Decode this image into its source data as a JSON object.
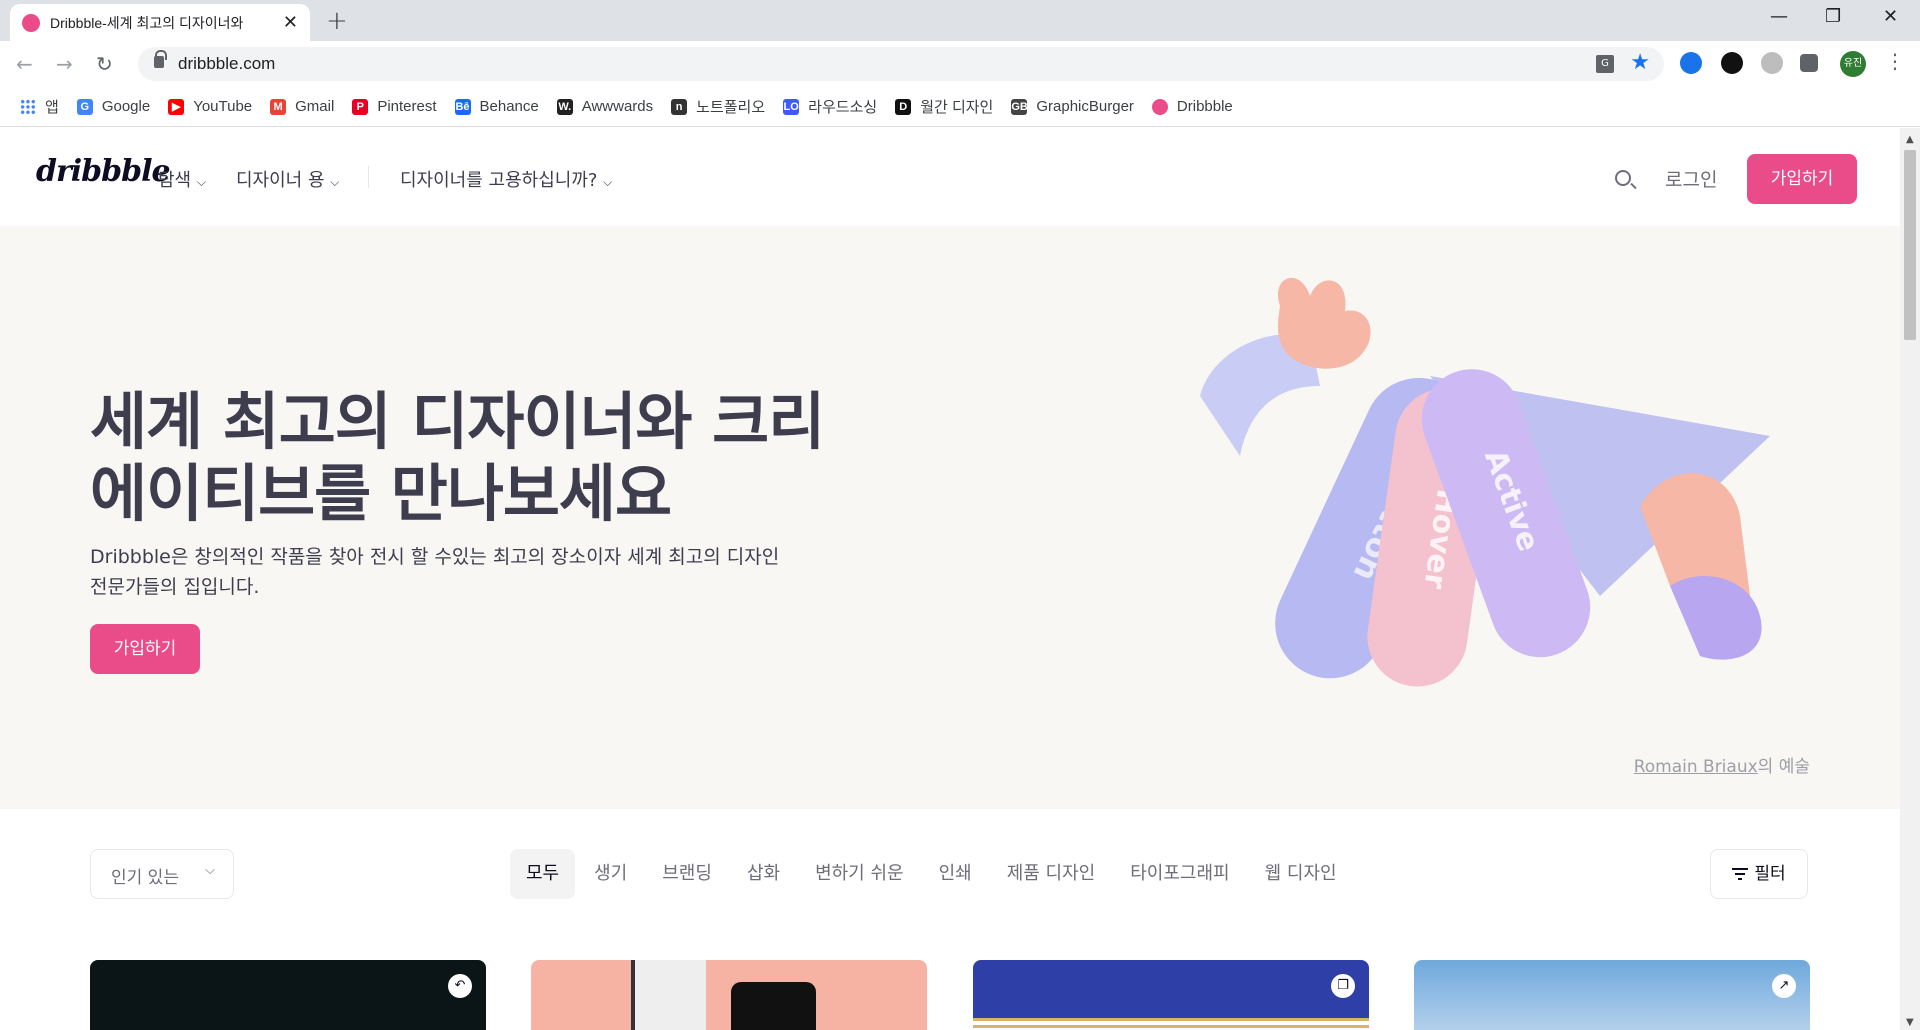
{
  "browser": {
    "tab_title": "Dribbble-세계 최고의 디자이너와",
    "tab_close": "✕",
    "new_tab": "+",
    "url": "dribbble.com",
    "translate_glyph": "G",
    "profile_initials": "유진",
    "window_controls": {
      "minimize": "—",
      "maximize": "❐",
      "close": "✕"
    },
    "nav": {
      "back": "←",
      "forward": "→",
      "reload": "↻"
    },
    "bookmarks": [
      {
        "label": "앱",
        "icon": "apps-grid-icon",
        "color": "#ea4335"
      },
      {
        "label": "Google",
        "icon": "google-icon",
        "color": "#4285f4",
        "glyph": "G"
      },
      {
        "label": "YouTube",
        "icon": "youtube-icon",
        "color": "#ff0000",
        "glyph": "▶"
      },
      {
        "label": "Gmail",
        "icon": "gmail-icon",
        "color": "#ea4335",
        "glyph": "M"
      },
      {
        "label": "Pinterest",
        "icon": "pinterest-icon",
        "color": "#e60023",
        "glyph": "P"
      },
      {
        "label": "Behance",
        "icon": "behance-icon",
        "color": "#1769ff",
        "glyph": "Bē"
      },
      {
        "label": "Awwwards",
        "icon": "awwwards-icon",
        "color": "#222222",
        "glyph": "W."
      },
      {
        "label": "노트폴리오",
        "icon": "notefolio-icon",
        "color": "#333333",
        "glyph": "n"
      },
      {
        "label": "라우드소싱",
        "icon": "loudsourcing-icon",
        "color": "#3d5afe",
        "glyph": "LO"
      },
      {
        "label": "월간 디자인",
        "icon": "monthly-design-icon",
        "color": "#111111",
        "glyph": "D"
      },
      {
        "label": "GraphicBurger",
        "icon": "graphicburger-icon",
        "color": "#444444",
        "glyph": "GB"
      },
      {
        "label": "Dribbble",
        "icon": "dribbble-icon",
        "color": "#ea4c89",
        "glyph": ""
      }
    ]
  },
  "header": {
    "logo": "dribbble",
    "nav": [
      "탐색",
      "디자이너 용",
      "디자이너를 고용하십니까?"
    ],
    "login": "로그인",
    "signup": "가입하기"
  },
  "hero": {
    "title_line1": "세계 최고의 디자이너와 크리",
    "title_line2": "에이티브를 만나보세요",
    "lead_line1": "Dribbble은 창의적인 작품을 찾아 전시 할 수있는 최고의 장소이자 세계 최고의 디자인",
    "lead_line2": "전문가들의 집입니다.",
    "signup": "가입하기",
    "art_tags": [
      "Button",
      "Hover",
      "Active"
    ],
    "credit_author": "Romain Briaux",
    "credit_suffix": "의 예술"
  },
  "filters": {
    "sort_value": "인기 있는",
    "categories": [
      "모두",
      "생기",
      "브랜딩",
      "삽화",
      "변하기 쉬운",
      "인쇄",
      "제품 디자인",
      "타이포그래피",
      "웹 디자인"
    ],
    "active_category": "모두",
    "filter_label": "필터"
  },
  "colors": {
    "brand_pink": "#ea4c89",
    "hero_bg": "#f8f7f4",
    "text_dark": "#3d3d4e",
    "text_muted": "#6e6d7a"
  },
  "shots": [
    {
      "name": "shot-dark",
      "bg": "#0b1416",
      "badge_icon": "undo-icon",
      "badge_glyph": "↶"
    },
    {
      "name": "shot-pink-phone",
      "bg": "#f6b3a3",
      "badge_icon": "",
      "badge_glyph": ""
    },
    {
      "name": "shot-blue-medals",
      "bg": "#2f3fa8",
      "badge_icon": "multi-shot-icon",
      "badge_glyph": "❐"
    },
    {
      "name": "shot-sky",
      "bg": "#6fa8dc",
      "badge_icon": "external-link-icon",
      "badge_glyph": "↗"
    }
  ]
}
